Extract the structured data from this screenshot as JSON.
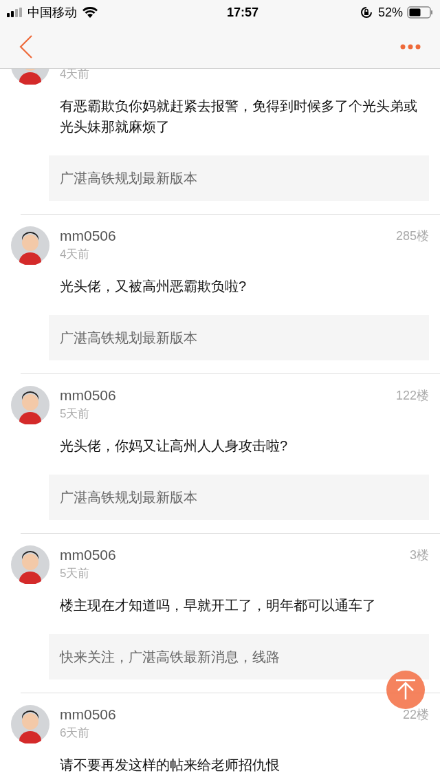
{
  "status_bar": {
    "carrier": "中国移动",
    "time": "17:57",
    "battery": "52%"
  },
  "comments": [
    {
      "time": "4天前",
      "body": "有恶霸欺负你妈就赶紧去报警，免得到时候多了个光头弟或光头妹那就麻烦了",
      "quote": "广湛高铁规划最新版本"
    },
    {
      "name": "mm0506",
      "floor": "285楼",
      "time": "4天前",
      "body": "光头佬，又被高州恶霸欺负啦?",
      "quote": "广湛高铁规划最新版本"
    },
    {
      "name": "mm0506",
      "floor": "122楼",
      "time": "5天前",
      "body": "光头佬，你妈又让高州人人身攻击啦?",
      "quote": "广湛高铁规划最新版本"
    },
    {
      "name": "mm0506",
      "floor": "3楼",
      "time": "5天前",
      "body": "楼主现在才知道吗，早就开工了，明年都可以通车了",
      "quote": "快来关注，广湛高铁最新消息，线路"
    },
    {
      "name": "mm0506",
      "floor": "22楼",
      "time": "6天前",
      "body": "请不要再发这样的帖来给老师招仇恨"
    }
  ]
}
